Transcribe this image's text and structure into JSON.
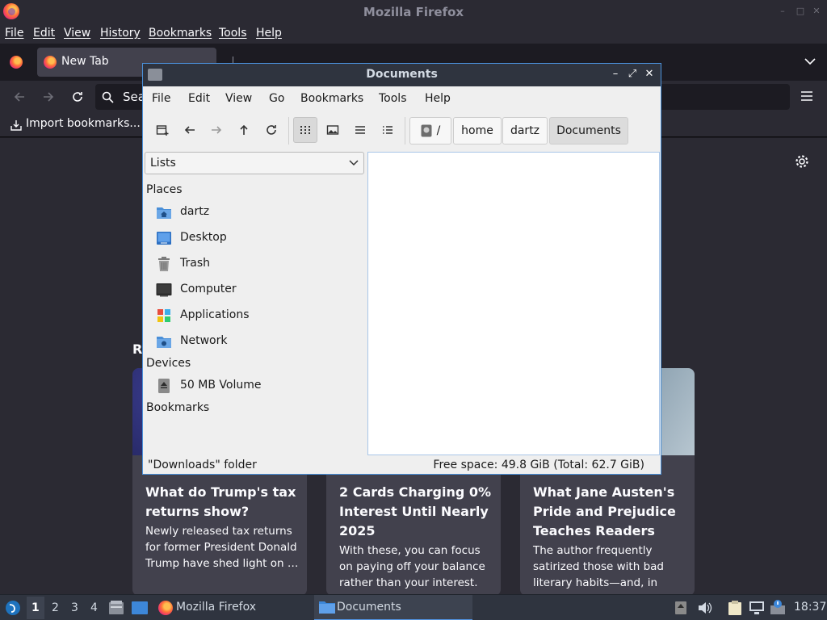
{
  "firefox": {
    "window_title": "Mozilla Firefox",
    "menu": [
      "File",
      "Edit",
      "View",
      "History",
      "Bookmarks",
      "Tools",
      "Help"
    ],
    "tab_title": "New Tab",
    "url_placeholder": "Sea",
    "bookmarks_toolbar_item": "Import bookmarks...",
    "section_heading_partial": "R",
    "cards": [
      {
        "source": "",
        "headline": "What do Trump's tax returns show?",
        "description": "Newly released tax returns for former President Donald Trump have shed light on …"
      },
      {
        "source": "",
        "headline": "2 Cards Charging 0% Interest Until Nearly 2025",
        "description": "With these, you can focus on paying off your balance rather than your interest."
      },
      {
        "source": "",
        "headline": "What Jane Austen's Pride and Prejudice Teaches Readers",
        "description": "The author frequently satirized those with bad literary habits—and, in her…"
      }
    ]
  },
  "file_manager": {
    "window_title": "Documents",
    "menu": [
      "File",
      "Edit",
      "View",
      "Go",
      "Bookmarks",
      "Tools",
      "Help"
    ],
    "breadcrumb": [
      "/",
      "home",
      "dartz",
      "Documents"
    ],
    "side_pane_mode": "Lists",
    "sections": {
      "places": "Places",
      "devices": "Devices",
      "bookmarks": "Bookmarks"
    },
    "places": [
      {
        "label": "dartz",
        "icon": "home-folder-icon"
      },
      {
        "label": "Desktop",
        "icon": "desktop-icon"
      },
      {
        "label": "Trash",
        "icon": "trash-icon"
      },
      {
        "label": "Computer",
        "icon": "computer-icon"
      },
      {
        "label": "Applications",
        "icon": "applications-icon"
      },
      {
        "label": "Network",
        "icon": "network-folder-icon"
      }
    ],
    "devices": [
      {
        "label": "50 MB Volume",
        "icon": "drive-icon"
      }
    ],
    "status_left": "\"Downloads\" folder",
    "status_right": "Free space: 49.8 GiB (Total: 62.7 GiB)"
  },
  "taskbar": {
    "workspaces": [
      "1",
      "2",
      "3",
      "4"
    ],
    "tasks": [
      {
        "label": "Mozilla Firefox",
        "icon": "firefox-icon"
      },
      {
        "label": "Documents",
        "icon": "folder-icon"
      }
    ],
    "clock": "18:37"
  },
  "colors": {
    "ff_dark": "#1c1b22",
    "ff_toolbar": "#2b2a33",
    "fm_titlebar": "#2f343f",
    "fm_accent": "#4a90d9"
  }
}
